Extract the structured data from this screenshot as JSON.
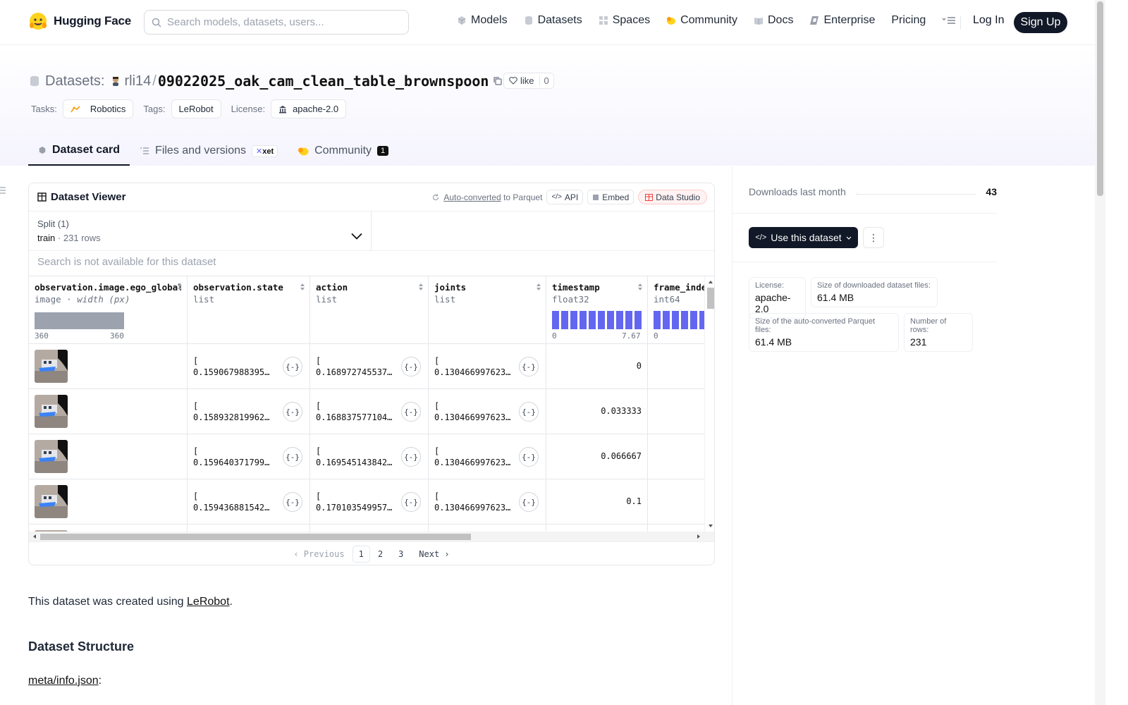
{
  "nav": {
    "brand": "Hugging Face",
    "search_placeholder": "Search models, datasets, users...",
    "links": [
      "Models",
      "Datasets",
      "Spaces",
      "Community",
      "Docs",
      "Enterprise",
      "Pricing"
    ],
    "login": "Log In",
    "signup": "Sign Up"
  },
  "header": {
    "section": "Datasets:",
    "user": "rli14",
    "separator": "/",
    "dataset_name": "09022025_oak_cam_clean_table_brownspoon",
    "like_label": "like",
    "like_count": "0",
    "tasks_label": "Tasks:",
    "task": "Robotics",
    "tags_label": "Tags:",
    "tag": "LeRobot",
    "license_label": "License:",
    "license": "apache-2.0"
  },
  "tabs": {
    "card": "Dataset card",
    "files": "Files and versions",
    "xet": "xet",
    "community": "Community",
    "community_count": "1"
  },
  "viewer": {
    "title": "Dataset Viewer",
    "auto_converted": "Auto-converted",
    "to_parquet": "to Parquet",
    "api": "API",
    "embed": "Embed",
    "studio": "Data Studio",
    "split_label": "Split (1)",
    "split_name": "train",
    "split_dot": "·",
    "split_rows": "231 rows",
    "search_na": "Search is not available for this dataset",
    "columns": [
      {
        "name": "observation.image.ego_global",
        "type": "image",
        "type_extra": "· width (px)",
        "hist_min": "360",
        "hist_max": "360"
      },
      {
        "name": "observation.state",
        "type": "list"
      },
      {
        "name": "action",
        "type": "list"
      },
      {
        "name": "joints",
        "type": "list"
      },
      {
        "name": "timestamp",
        "type": "float32",
        "hist_min": "0",
        "hist_max": "7.67"
      },
      {
        "name": "frame_index",
        "type": "int64",
        "hist_min": "0"
      }
    ],
    "rows": [
      {
        "state": "0.15906798839569…",
        "action": "0.1689727455377…",
        "joints": "0.1304669976234…",
        "timestamp": "0"
      },
      {
        "state": "0.15893281996250…",
        "action": "0.1688375771045…",
        "joints": "0.1304669976234…",
        "timestamp": "0.033333"
      },
      {
        "state": "0.15964037179946…",
        "action": "0.1695451438426…",
        "joints": "0.1304669976234…",
        "timestamp": "0.066667"
      },
      {
        "state": "0.15943688154220…",
        "action": "0.1701035499572…",
        "joints": "0.1304669976234…",
        "timestamp": "0.1"
      }
    ],
    "list_open": "[",
    "brace": "{-}",
    "pager": {
      "prev": "Previous",
      "pages": [
        "1",
        "2",
        "3"
      ],
      "next": "Next"
    }
  },
  "body": {
    "created_prefix": "This dataset was created using ",
    "created_link": "LeRobot",
    "created_suffix": ".",
    "structure_heading": "Dataset Structure",
    "meta_link": "meta/info.json",
    "meta_suffix": ":"
  },
  "sidebar": {
    "downloads_label": "Downloads last month",
    "downloads_value": "43",
    "use_dataset": "Use this dataset",
    "more": "⋮",
    "stats": [
      {
        "k": "License:",
        "v": "apache-2.0"
      },
      {
        "k": "Size of downloaded dataset files:",
        "v": "61.4 MB"
      },
      {
        "k": "Size of the auto-converted Parquet files:",
        "v": "61.4 MB"
      },
      {
        "k": "Number of rows:",
        "v": "231"
      }
    ]
  },
  "colors": {
    "accent_bar": "#6366f1",
    "primary_button": "#111827"
  }
}
